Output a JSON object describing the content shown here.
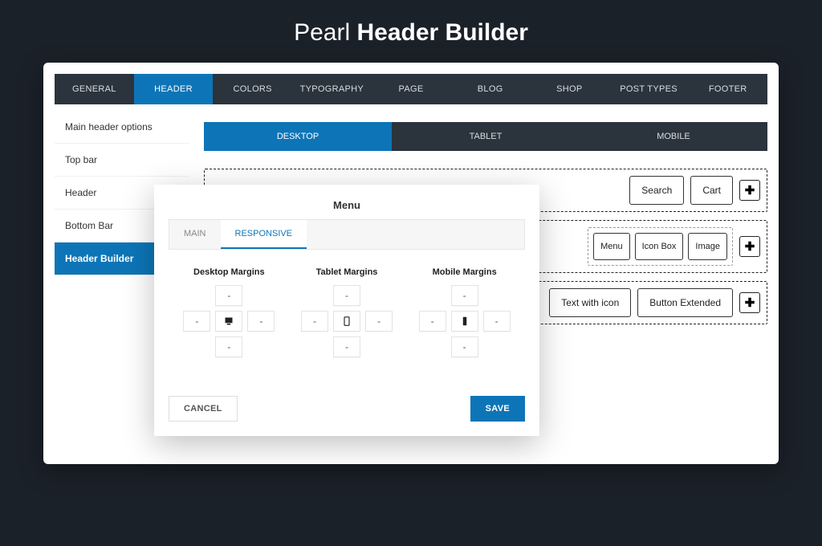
{
  "page_title_light": "Pearl",
  "page_title_bold": "Header Builder",
  "topnav": [
    "GENERAL",
    "HEADER",
    "COLORS",
    "TYPOGRAPHY",
    "PAGE",
    "BLOG",
    "SHOP",
    "POST TYPES",
    "FOOTER"
  ],
  "topnav_active": 1,
  "sidebar": [
    "Main header options",
    "Top bar",
    "Header",
    "Bottom Bar",
    "Header Builder"
  ],
  "sidebar_active": 4,
  "device_tabs": [
    "DESKTOP",
    "TABLET",
    "MOBILE"
  ],
  "device_active": 0,
  "builder_rows": [
    {
      "type": "simple",
      "blocks": [
        "Search",
        "Cart"
      ]
    },
    {
      "type": "sub",
      "blocks": [
        "Menu",
        "Icon Box",
        "Image"
      ]
    },
    {
      "type": "simple",
      "blocks": [
        "Text with icon",
        "Button Extended"
      ]
    }
  ],
  "modal": {
    "title": "Menu",
    "tabs": [
      "MAIN",
      "RESPONSIVE"
    ],
    "tab_active": 1,
    "margin_labels": [
      "Desktop Margins",
      "Tablet Margins",
      "Mobile Margins"
    ],
    "placeholder": "-",
    "cancel": "CANCEL",
    "save": "SAVE"
  }
}
